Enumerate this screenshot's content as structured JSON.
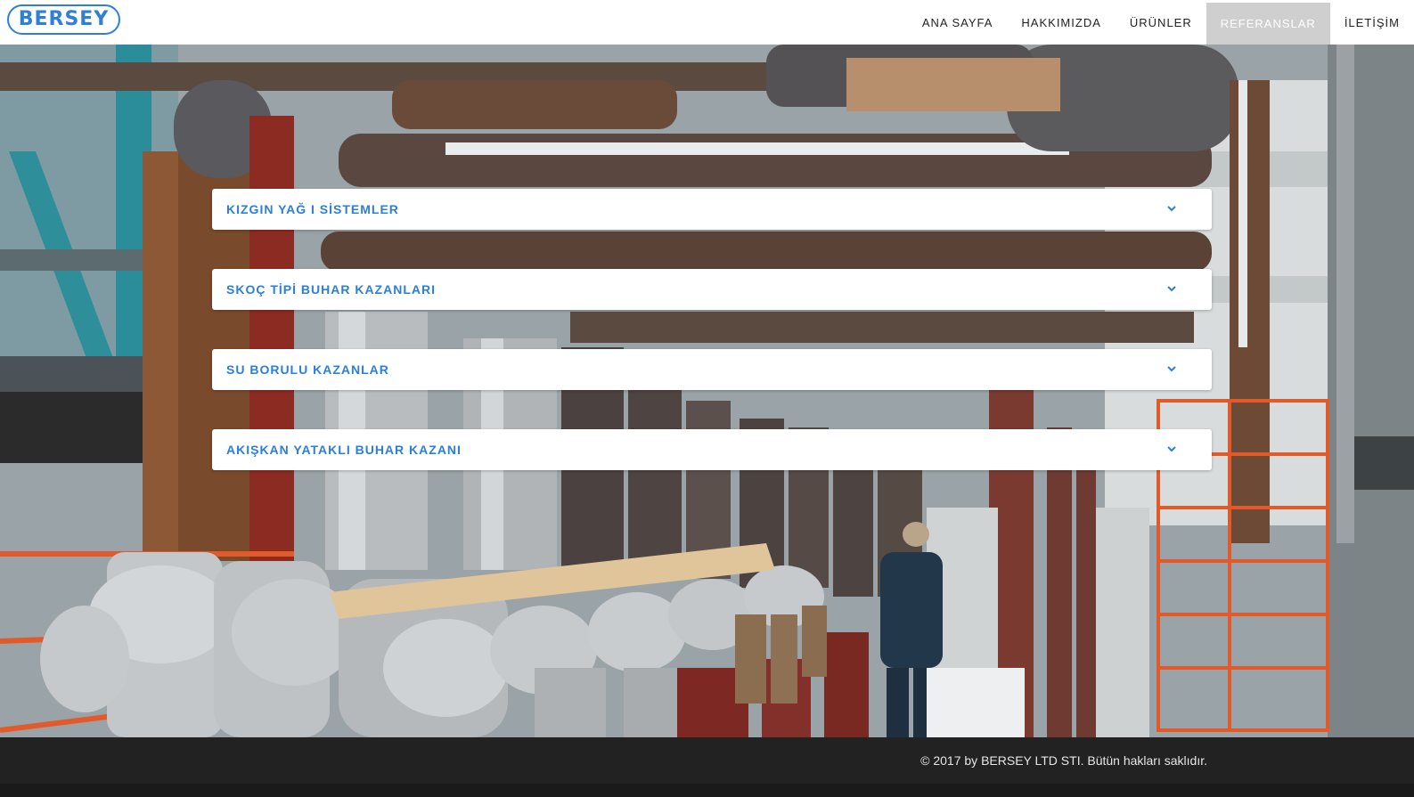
{
  "brand": {
    "logo_text": "BERSEY",
    "accent_color": "#2a7fdc"
  },
  "nav": {
    "items": [
      {
        "label": "ANA SAYFA"
      },
      {
        "label": "HAKKIMIZDA"
      },
      {
        "label": "ÜRÜNLER"
      },
      {
        "label": "REFERANSLAR"
      },
      {
        "label": "İLETİŞİM"
      }
    ],
    "active_index": 3
  },
  "accordion": {
    "items": [
      {
        "label": "KIZGIN YAĞ I SİSTEMLER",
        "icon": "chevron-down-icon"
      },
      {
        "label": "SKOÇ TİPİ BUHAR KAZANLARI",
        "icon": "chevron-down-icon"
      },
      {
        "label": "SU BORULU KAZANLAR",
        "icon": "chevron-down-icon"
      },
      {
        "label": "AKIŞKAN YATAKLI BUHAR KAZANI",
        "icon": "chevron-down-icon"
      }
    ]
  },
  "footer": {
    "copyright": "© 2017 by BERSEY LTD STI. Bütün hakları saklıdır."
  }
}
